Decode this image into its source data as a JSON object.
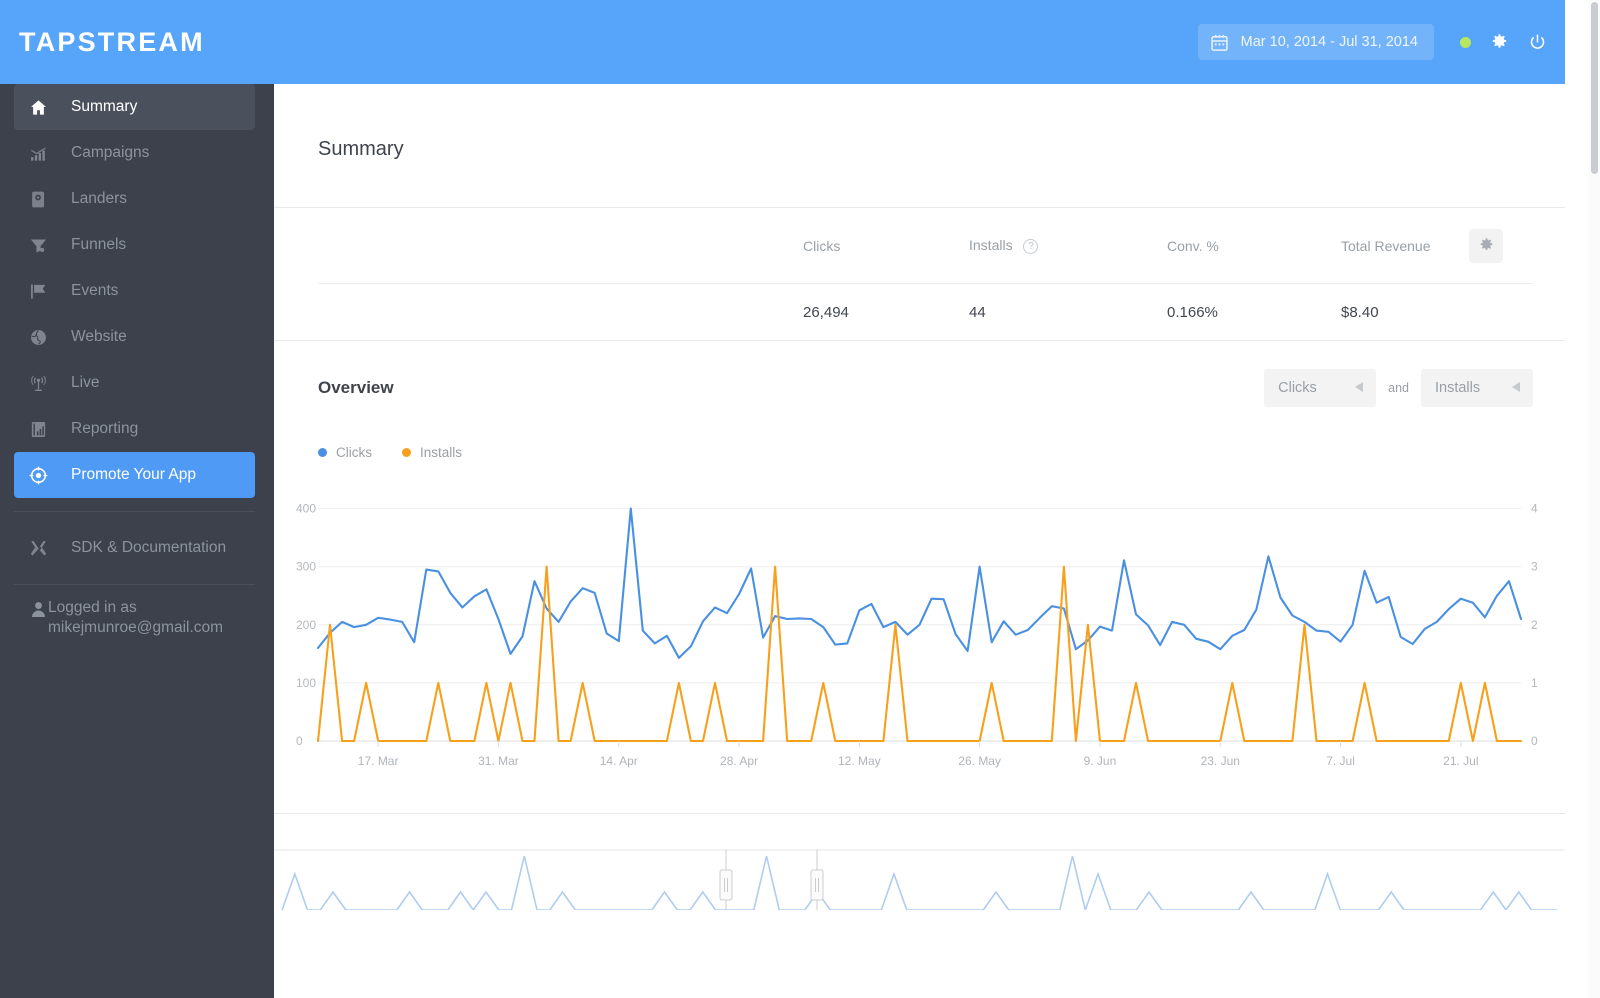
{
  "header": {
    "brand": "TAPSTREAM",
    "date_range": "Mar 10, 2014 - Jul 31, 2014",
    "calendar_icon": "calendar-icon",
    "status_dot_color": "#b8e762",
    "settings_icon": "gear-icon",
    "power_icon": "power-icon",
    "background": "#57a5fa"
  },
  "sidebar": {
    "items": [
      {
        "label": "Summary",
        "icon": "home-icon",
        "state": "active"
      },
      {
        "label": "Campaigns",
        "icon": "bar-chart-icon",
        "state": "normal"
      },
      {
        "label": "Landers",
        "icon": "page-icon",
        "state": "normal"
      },
      {
        "label": "Funnels",
        "icon": "funnel-icon",
        "state": "normal"
      },
      {
        "label": "Events",
        "icon": "flag-icon",
        "state": "normal"
      },
      {
        "label": "Website",
        "icon": "globe-icon",
        "state": "normal"
      },
      {
        "label": "Live",
        "icon": "broadcast-icon",
        "state": "normal"
      },
      {
        "label": "Reporting",
        "icon": "report-icon",
        "state": "normal"
      },
      {
        "label": "Promote Your App",
        "icon": "target-icon",
        "state": "promoted"
      }
    ],
    "docs": {
      "label": "SDK & Documentation",
      "icon": "tools-icon"
    },
    "user": {
      "icon": "user-icon",
      "line1": "Logged in as",
      "line2": "mikejmunroe@gmail.com"
    }
  },
  "main": {
    "page_title": "Summary",
    "stats": {
      "columns": [
        "",
        "Clicks",
        "Installs",
        "Conv. %",
        "Total Revenue"
      ],
      "installs_help": "?",
      "settings_icon": "gear-icon",
      "row": [
        "",
        "26,494",
        "44",
        "0.166%",
        "$8.40"
      ]
    },
    "overview": {
      "title": "Overview",
      "selector_primary": "Clicks",
      "selector_secondary": "Installs",
      "selector_conjunction": "and",
      "selector_arrow": "caret-left-icon",
      "legend": [
        {
          "label": "Clicks",
          "color": "#4a90e2"
        },
        {
          "label": "Installs",
          "color": "#f7a01c"
        }
      ]
    }
  },
  "chart_data": {
    "type": "line",
    "title": "Overview",
    "xlabel": "",
    "ylabel": "",
    "grid": true,
    "legend_position": "top-left",
    "y_left": {
      "label": "Clicks",
      "ticks": [
        0,
        100,
        200,
        300,
        400
      ],
      "ylim": [
        0,
        420
      ]
    },
    "y_right": {
      "label": "Installs",
      "ticks": [
        0,
        1,
        2,
        3,
        4
      ],
      "ylim": [
        0,
        4.2
      ]
    },
    "x_tick_labels": [
      "17. Mar",
      "31. Mar",
      "14. Apr",
      "28. Apr",
      "12. May",
      "26. May",
      "9. Jun",
      "23. Jun",
      "7. Jul",
      "21. Jul"
    ],
    "x_range": "Mar 10, 2014 - Jul 31, 2014",
    "series": [
      {
        "name": "Clicks",
        "color": "#4a90e2",
        "axis": "left",
        "values": [
          160,
          186,
          205,
          196,
          200,
          212,
          209,
          205,
          170,
          295,
          292,
          255,
          230,
          249,
          261,
          210,
          150,
          180,
          275,
          228,
          205,
          240,
          263,
          255,
          185,
          172,
          400,
          190,
          168,
          181,
          143,
          163,
          206,
          230,
          220,
          253,
          297,
          178,
          215,
          210,
          211,
          210,
          196,
          166,
          168,
          225,
          236,
          196,
          205,
          183,
          200,
          245,
          244,
          184,
          155,
          300,
          170,
          206,
          183,
          191,
          212,
          232,
          228,
          158,
          173,
          197,
          190,
          311,
          218,
          199,
          165,
          205,
          200,
          176,
          171,
          158,
          181,
          191,
          226,
          318,
          247,
          216,
          205,
          190,
          188,
          171,
          200,
          293,
          238,
          248,
          179,
          167,
          193,
          205,
          227,
          245,
          238,
          213,
          250,
          275,
          210
        ]
      },
      {
        "name": "Installs",
        "color": "#f7a01c",
        "axis": "right",
        "values": [
          0,
          2,
          0,
          0,
          1,
          0,
          0,
          0,
          0,
          0,
          1,
          0,
          0,
          0,
          1,
          0,
          1,
          0,
          0,
          3,
          0,
          0,
          1,
          0,
          0,
          0,
          0,
          0,
          0,
          0,
          1,
          0,
          0,
          1,
          0,
          0,
          0,
          0,
          3,
          0,
          0,
          0,
          1,
          0,
          0,
          0,
          0,
          0,
          2,
          0,
          0,
          0,
          0,
          0,
          0,
          0,
          1,
          0,
          0,
          0,
          0,
          0,
          3,
          0,
          2,
          0,
          0,
          0,
          1,
          0,
          0,
          0,
          0,
          0,
          0,
          0,
          1,
          0,
          0,
          0,
          0,
          0,
          2,
          0,
          0,
          0,
          0,
          1,
          0,
          0,
          0,
          0,
          0,
          0,
          0,
          1,
          0,
          1,
          0,
          0,
          0
        ]
      }
    ]
  },
  "navigator": {
    "left_handle": "range-handle-left",
    "right_handle": "range-handle-right",
    "series_color": "#aecdf0"
  },
  "scrollbar": {
    "thumb_color": "#c9ccd0"
  }
}
